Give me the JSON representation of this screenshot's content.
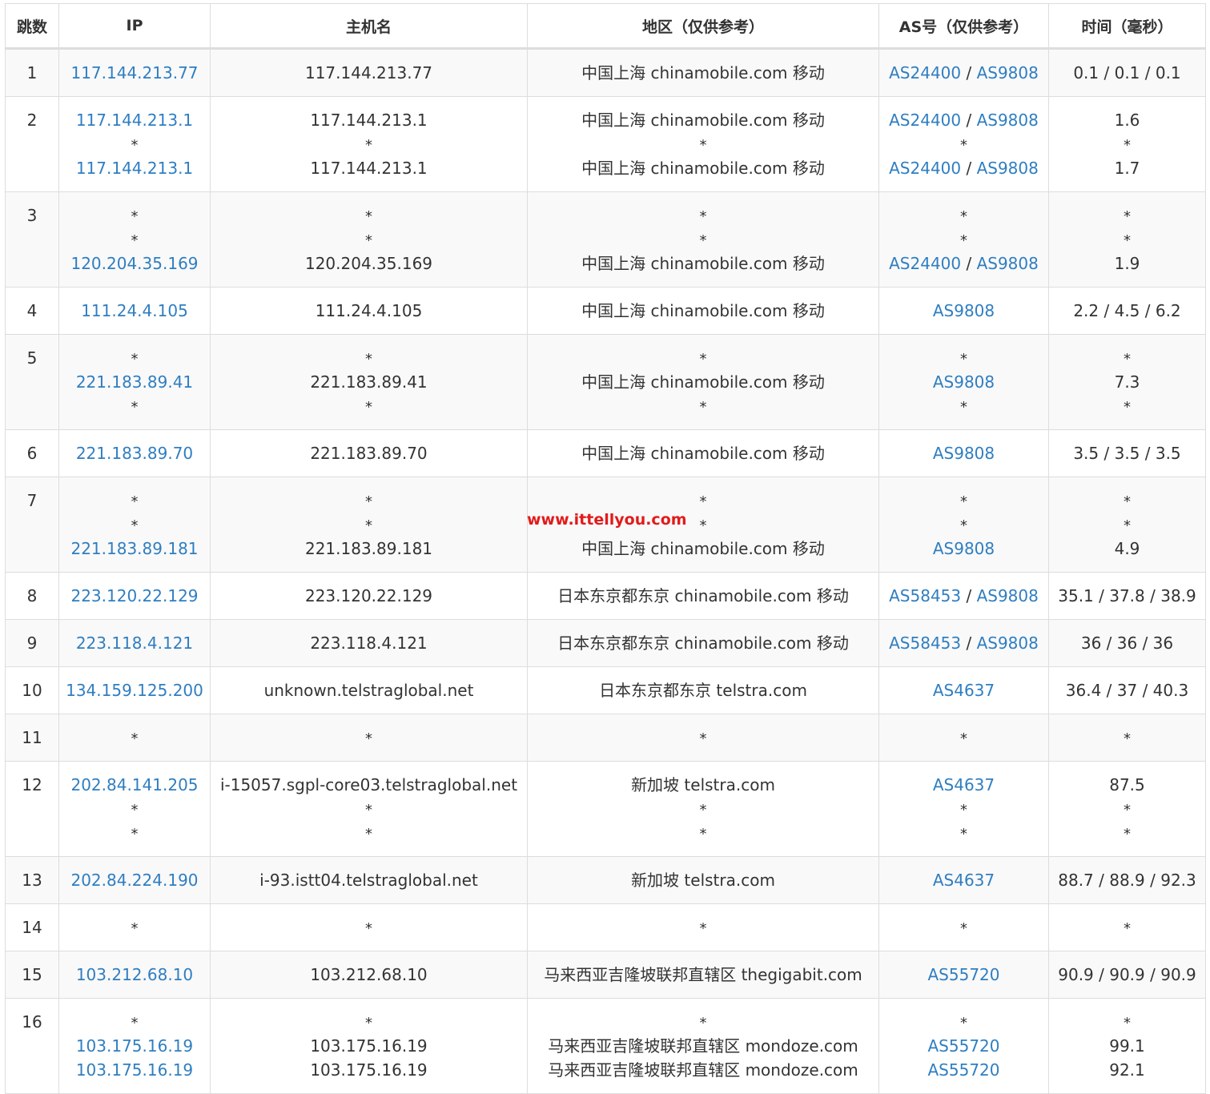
{
  "headers": [
    "跳数",
    "IP",
    "主机名",
    "地区（仅供参考）",
    "AS号（仅供参考）",
    "时间（毫秒）"
  ],
  "rows": [
    {
      "hop": "1",
      "lines": [
        {
          "ip": "117.144.213.77",
          "host": "117.144.213.77",
          "region": "中国上海 chinamobile.com 移动",
          "as": [
            "AS24400",
            "AS9808"
          ],
          "time": "0.1 / 0.1 / 0.1"
        }
      ]
    },
    {
      "hop": "2",
      "lines": [
        {
          "ip": "117.144.213.1",
          "host": "117.144.213.1",
          "region": "中国上海 chinamobile.com 移动",
          "as": [
            "AS24400",
            "AS9808"
          ],
          "time": "1.6"
        },
        {
          "ip": "*",
          "host": "*",
          "region": "*",
          "as": [
            "*"
          ],
          "time": "*"
        },
        {
          "ip": "117.144.213.1",
          "host": "117.144.213.1",
          "region": "中国上海 chinamobile.com 移动",
          "as": [
            "AS24400",
            "AS9808"
          ],
          "time": "1.7"
        }
      ]
    },
    {
      "hop": "3",
      "lines": [
        {
          "ip": "*",
          "host": "*",
          "region": "*",
          "as": [
            "*"
          ],
          "time": "*"
        },
        {
          "ip": "*",
          "host": "*",
          "region": "*",
          "as": [
            "*"
          ],
          "time": "*"
        },
        {
          "ip": "120.204.35.169",
          "host": "120.204.35.169",
          "region": "中国上海 chinamobile.com 移动",
          "as": [
            "AS24400",
            "AS9808"
          ],
          "time": "1.9"
        }
      ]
    },
    {
      "hop": "4",
      "lines": [
        {
          "ip": "111.24.4.105",
          "host": "111.24.4.105",
          "region": "中国上海 chinamobile.com 移动",
          "as": [
            "AS9808"
          ],
          "time": "2.2 / 4.5 / 6.2"
        }
      ]
    },
    {
      "hop": "5",
      "lines": [
        {
          "ip": "*",
          "host": "*",
          "region": "*",
          "as": [
            "*"
          ],
          "time": "*"
        },
        {
          "ip": "221.183.89.41",
          "host": "221.183.89.41",
          "region": "中国上海 chinamobile.com 移动",
          "as": [
            "AS9808"
          ],
          "time": "7.3"
        },
        {
          "ip": "*",
          "host": "*",
          "region": "*",
          "as": [
            "*"
          ],
          "time": "*"
        }
      ]
    },
    {
      "hop": "6",
      "lines": [
        {
          "ip": "221.183.89.70",
          "host": "221.183.89.70",
          "region": "中国上海 chinamobile.com 移动",
          "as": [
            "AS9808"
          ],
          "time": "3.5 / 3.5 / 3.5"
        }
      ]
    },
    {
      "hop": "7",
      "lines": [
        {
          "ip": "*",
          "host": "*",
          "region": "*",
          "as": [
            "*"
          ],
          "time": "*"
        },
        {
          "ip": "*",
          "host": "*",
          "region": "*",
          "as": [
            "*"
          ],
          "time": "*"
        },
        {
          "ip": "221.183.89.181",
          "host": "221.183.89.181",
          "region": "中国上海 chinamobile.com 移动",
          "as": [
            "AS9808"
          ],
          "time": "4.9"
        }
      ]
    },
    {
      "hop": "8",
      "lines": [
        {
          "ip": "223.120.22.129",
          "host": "223.120.22.129",
          "region": "日本东京都东京 chinamobile.com 移动",
          "as": [
            "AS58453",
            "AS9808"
          ],
          "time": "35.1 / 37.8 / 38.9"
        }
      ]
    },
    {
      "hop": "9",
      "lines": [
        {
          "ip": "223.118.4.121",
          "host": "223.118.4.121",
          "region": "日本东京都东京 chinamobile.com 移动",
          "as": [
            "AS58453",
            "AS9808"
          ],
          "time": "36 / 36 / 36"
        }
      ]
    },
    {
      "hop": "10",
      "lines": [
        {
          "ip": "134.159.125.200",
          "host": "unknown.telstraglobal.net",
          "region": "日本东京都东京 telstra.com",
          "as": [
            "AS4637"
          ],
          "time": "36.4 / 37 / 40.3"
        }
      ]
    },
    {
      "hop": "11",
      "lines": [
        {
          "ip": "*",
          "host": "*",
          "region": "*",
          "as": [
            "*"
          ],
          "time": "*"
        }
      ]
    },
    {
      "hop": "12",
      "lines": [
        {
          "ip": "202.84.141.205",
          "host": "i-15057.sgpl-core03.telstraglobal.net",
          "region": "新加坡 telstra.com",
          "as": [
            "AS4637"
          ],
          "time": "87.5"
        },
        {
          "ip": "*",
          "host": "*",
          "region": "*",
          "as": [
            "*"
          ],
          "time": "*"
        },
        {
          "ip": "*",
          "host": "*",
          "region": "*",
          "as": [
            "*"
          ],
          "time": "*"
        }
      ]
    },
    {
      "hop": "13",
      "lines": [
        {
          "ip": "202.84.224.190",
          "host": "i-93.istt04.telstraglobal.net",
          "region": "新加坡 telstra.com",
          "as": [
            "AS4637"
          ],
          "time": "88.7 / 88.9 / 92.3"
        }
      ]
    },
    {
      "hop": "14",
      "lines": [
        {
          "ip": "*",
          "host": "*",
          "region": "*",
          "as": [
            "*"
          ],
          "time": "*"
        }
      ]
    },
    {
      "hop": "15",
      "lines": [
        {
          "ip": "103.212.68.10",
          "host": "103.212.68.10",
          "region": "马来西亚吉隆坡联邦直辖区 thegigabit.com",
          "as": [
            "AS55720"
          ],
          "time": "90.9 / 90.9 / 90.9"
        }
      ]
    },
    {
      "hop": "16",
      "lines": [
        {
          "ip": "*",
          "host": "*",
          "region": "*",
          "as": [
            "*"
          ],
          "time": "*"
        },
        {
          "ip": "103.175.16.19",
          "host": "103.175.16.19",
          "region": "马来西亚吉隆坡联邦直辖区 mondoze.com",
          "as": [
            "AS55720"
          ],
          "time": "99.1"
        },
        {
          "ip": "103.175.16.19",
          "host": "103.175.16.19",
          "region": "马来西亚吉隆坡联邦直辖区 mondoze.com",
          "as": [
            "AS55720"
          ],
          "time": "92.1"
        }
      ]
    }
  ],
  "as_separator": " / ",
  "watermark": "www.ittellyou.com",
  "colors": {
    "link": "#2f7ec1",
    "text": "#333333",
    "border": "#dddddd",
    "stripe": "#f9f9f9",
    "watermark": "#e21b1b"
  }
}
